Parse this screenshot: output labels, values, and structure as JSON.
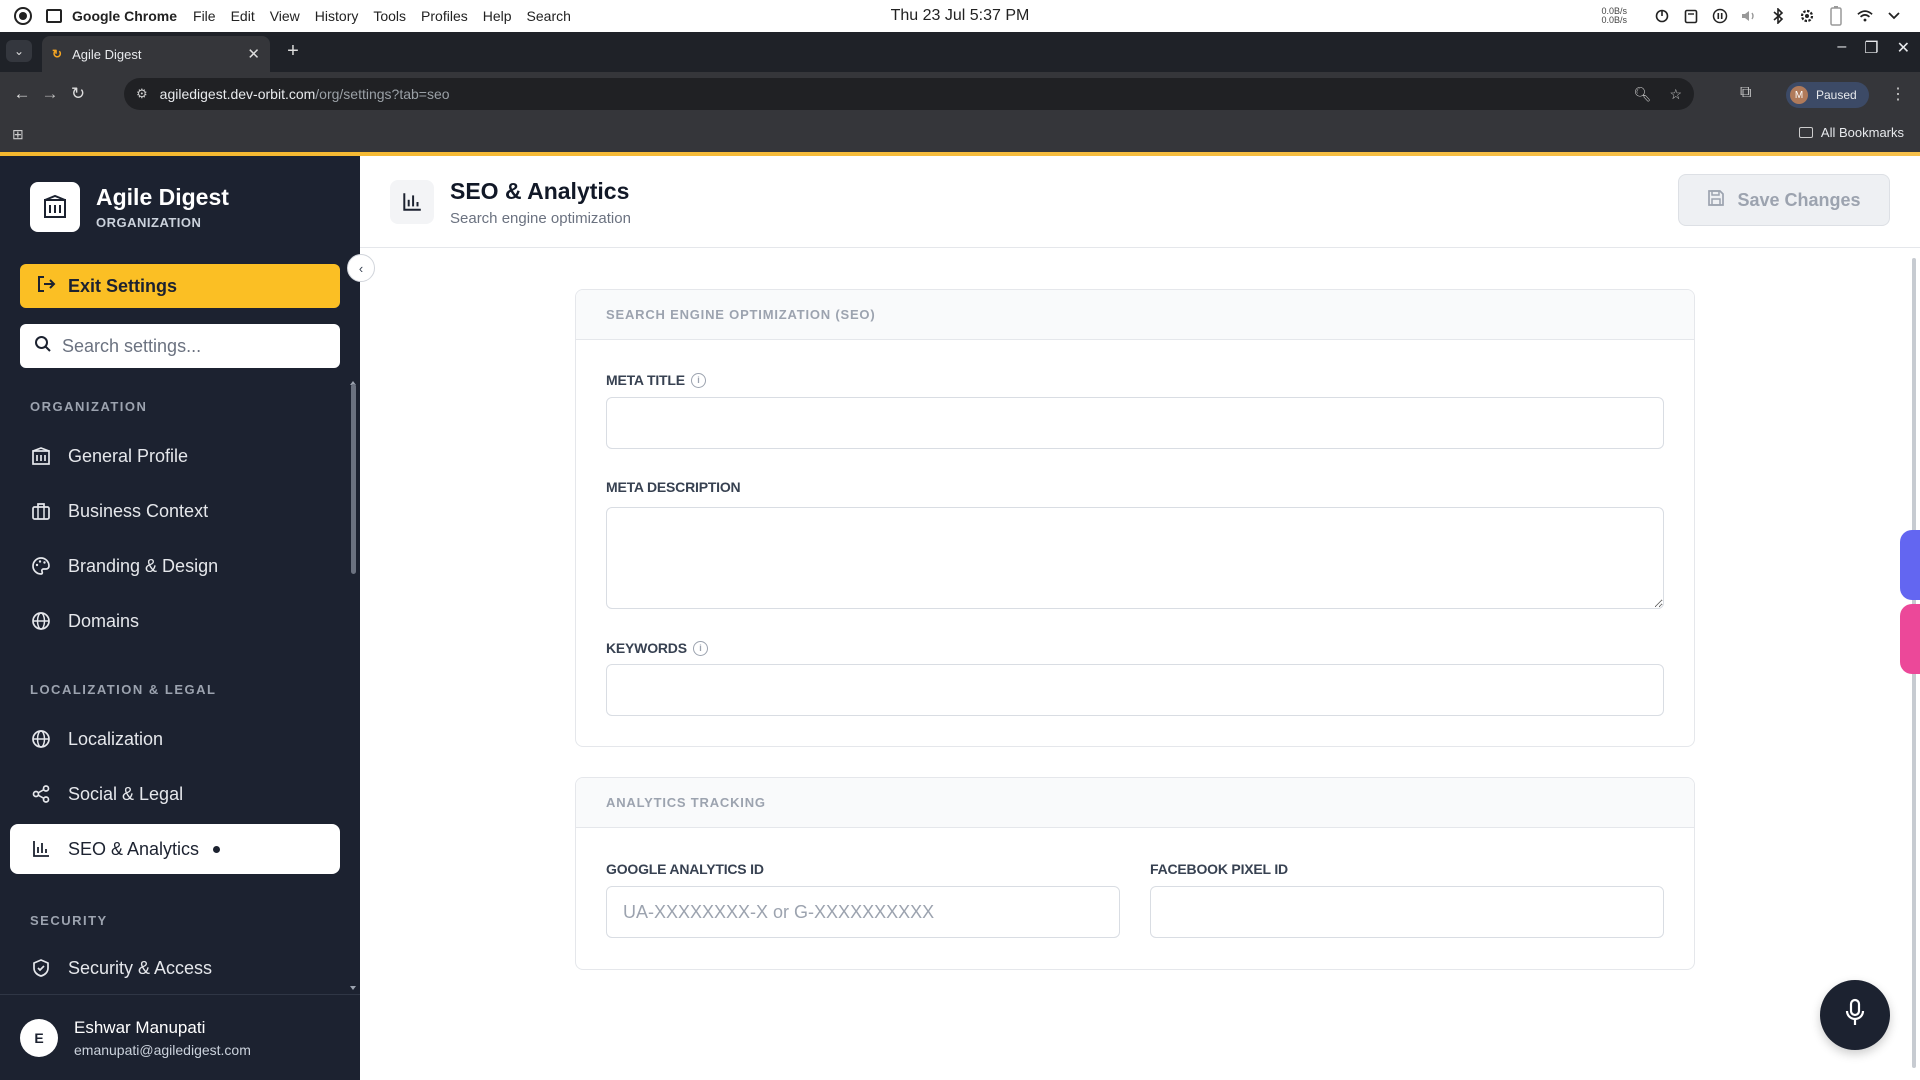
{
  "os": {
    "app_name": "Google Chrome",
    "menus": [
      "File",
      "Edit",
      "View",
      "History",
      "Tools",
      "Profiles",
      "Help",
      "Search"
    ],
    "clock": "Thu 23 Jul  5:37 PM",
    "net_up": "0.0B/s",
    "net_down": "0.0B/s"
  },
  "browser": {
    "tab_title": "Agile Digest",
    "url_host": "agiledigest.dev-orbit.com",
    "url_path": "/org/settings?tab=seo",
    "profile_initial": "M",
    "profile_status": "Paused",
    "bookmarks_label": "All Bookmarks"
  },
  "sidebar": {
    "brand_name": "Agile Digest",
    "brand_sub": "ORGANIZATION",
    "exit_label": "Exit Settings",
    "search_placeholder": "Search settings...",
    "sections": [
      {
        "label": "ORGANIZATION",
        "items": [
          {
            "label": "General Profile",
            "icon": "building-icon"
          },
          {
            "label": "Business Context",
            "icon": "briefcase-icon"
          },
          {
            "label": "Branding & Design",
            "icon": "palette-icon"
          },
          {
            "label": "Domains",
            "icon": "globe-icon"
          }
        ]
      },
      {
        "label": "LOCALIZATION & LEGAL",
        "items": [
          {
            "label": "Localization",
            "icon": "globe-icon"
          },
          {
            "label": "Social & Legal",
            "icon": "share-icon"
          },
          {
            "label": "SEO & Analytics",
            "icon": "bar-chart-icon",
            "active": true
          }
        ]
      },
      {
        "label": "SECURITY",
        "items": [
          {
            "label": "Security & Access",
            "icon": "shield-icon"
          }
        ]
      }
    ],
    "user": {
      "initial": "E",
      "name": "Eshwar Manupati",
      "email": "emanupati@agiledigest.com"
    }
  },
  "header": {
    "title": "SEO & Analytics",
    "subtitle": "Search engine optimization",
    "save_label": "Save Changes"
  },
  "seo_card": {
    "heading": "SEARCH ENGINE OPTIMIZATION (SEO)",
    "meta_title_label": "META TITLE",
    "meta_title_value": "",
    "meta_description_label": "META DESCRIPTION",
    "meta_description_value": "",
    "keywords_label": "KEYWORDS",
    "keywords_value": ""
  },
  "analytics_card": {
    "heading": "ANALYTICS TRACKING",
    "ga_label": "GOOGLE ANALYTICS ID",
    "ga_placeholder": "UA-XXXXXXXX-X or G-XXXXXXXXXX",
    "fb_label": "FACEBOOK PIXEL ID",
    "fb_value": ""
  },
  "colors": {
    "accent": "#fbbf24",
    "sidebar_bg": "#1c2230",
    "side_tab_blue": "#6366f1",
    "side_tab_pink": "#ec4899"
  }
}
